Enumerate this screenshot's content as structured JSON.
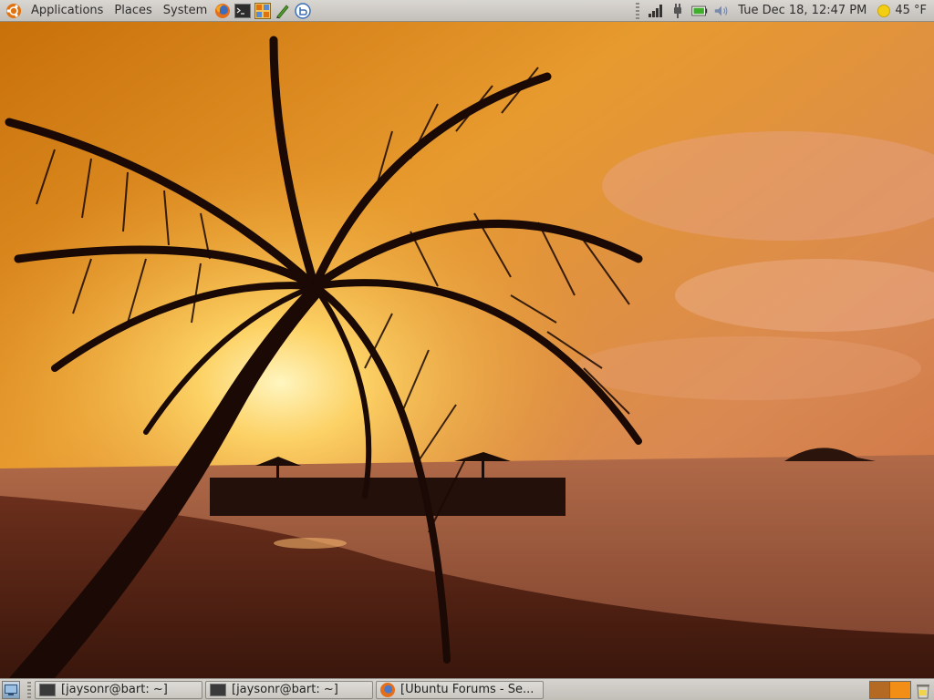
{
  "top_panel": {
    "menus": [
      {
        "label": "Applications",
        "icon": "ubuntu-logo-icon"
      },
      {
        "label": "Places"
      },
      {
        "label": "System"
      }
    ],
    "launchers": [
      "firefox-icon",
      "terminal-icon",
      "app-grid-icon",
      "text-editor-pen-icon",
      "help-icon"
    ],
    "tray": {
      "icons": [
        "network-signal-icon",
        "power-plug-icon",
        "battery-icon",
        "volume-icon"
      ],
      "clock": "Tue Dec 18, 12:47 PM",
      "weather": "45 °F"
    }
  },
  "bottom_panel": {
    "show_desktop_icon": "show-desktop-icon",
    "tasks": [
      {
        "label": "[jaysonr@bart: ~]",
        "icon": "terminal-icon"
      },
      {
        "label": "[jaysonr@bart: ~]",
        "icon": "terminal-icon"
      },
      {
        "label": "[Ubuntu Forums - Se...",
        "icon": "firefox-icon"
      }
    ],
    "workspaces": 2,
    "active_workspace": 2,
    "trash_icon": "trash-icon"
  },
  "desktop": {
    "wallpaper": "tropical-beach-sunset-palm-tree"
  },
  "colors": {
    "panel_bg": "#cfccc6",
    "workspace_active": "#f28d16",
    "workspace_inactive": "#b46a22"
  }
}
